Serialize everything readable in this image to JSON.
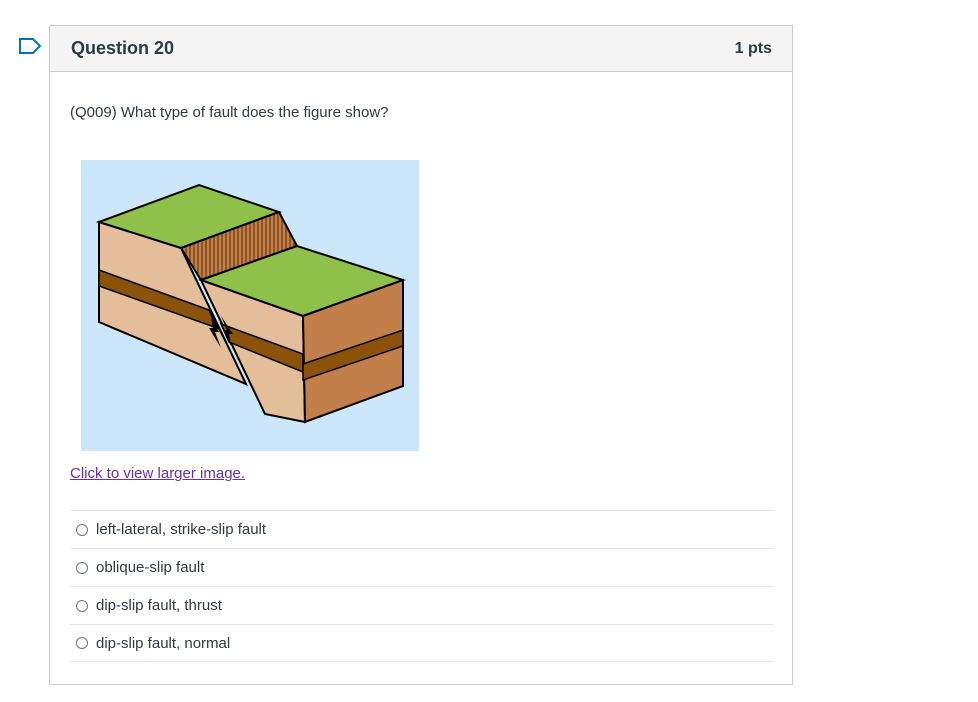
{
  "question": {
    "title": "Question 20",
    "points": "1 pts",
    "text": "(Q009) What type of fault does the figure show?",
    "image_link": "Click to view larger image."
  },
  "answers": [
    {
      "label": "left-lateral, strike-slip fault"
    },
    {
      "label": "oblique-slip fault"
    },
    {
      "label": "dip-slip fault, thrust"
    },
    {
      "label": "dip-slip fault, normal"
    }
  ],
  "colors": {
    "flag": "#0374b5",
    "figure_bg": "#cce6fb",
    "grass": "#8fc04a",
    "rock_light": "#e4bd9b",
    "rock_dark": "#c27f49",
    "layer": "#8b5209",
    "link": "#6b2fa6"
  }
}
